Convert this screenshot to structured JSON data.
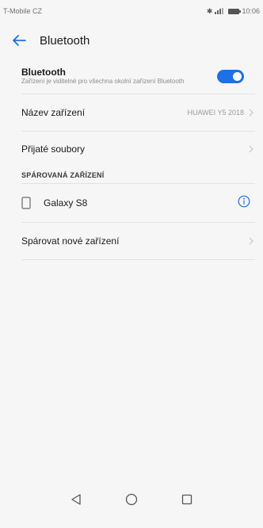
{
  "status_bar": {
    "carrier": "T-Mobile CZ",
    "time": "10:06"
  },
  "app_bar": {
    "title": "Bluetooth",
    "back_icon": "arrow-left-icon"
  },
  "bluetooth": {
    "title": "Bluetooth",
    "subtitle": "Zařízení je viditelné pro všechna okolní zařízení Bluetooth",
    "enabled": true
  },
  "device_name": {
    "label": "Název zařízení",
    "value": "HUAWEI Y5 2018"
  },
  "received_files": {
    "label": "Přijaté soubory"
  },
  "paired_section": {
    "header": "SPÁROVANÁ ZAŘÍZENÍ",
    "devices": [
      {
        "name": "Galaxy S8",
        "icon": "phone-icon",
        "action_icon": "info-icon"
      }
    ]
  },
  "pair_new": {
    "label": "Spárovat nové zařízení"
  },
  "nav_bar": {
    "buttons": [
      "back-triangle-icon",
      "home-circle-icon",
      "recents-square-icon"
    ]
  },
  "colors": {
    "accent": "#1f6fe5",
    "background": "#f6f6f6",
    "divider": "#e2e2e2"
  }
}
